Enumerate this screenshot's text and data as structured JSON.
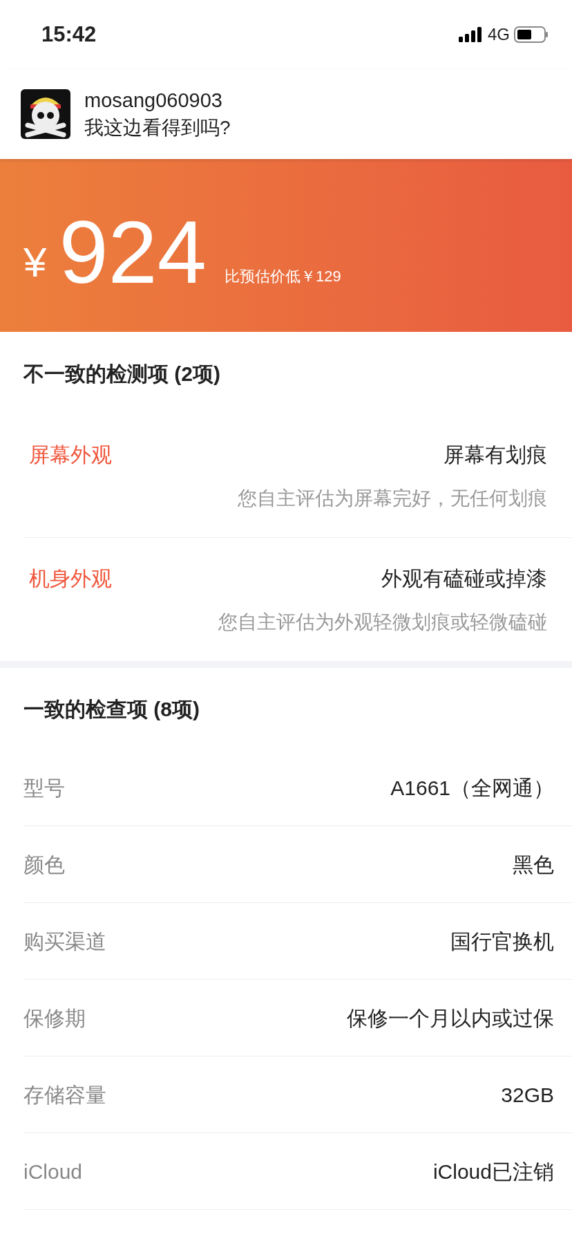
{
  "status_bar": {
    "time": "15:42",
    "network": "4G"
  },
  "notification": {
    "sender": "mosang060903",
    "message": "我这边看得到吗?"
  },
  "price": {
    "currency": "¥",
    "amount": "924",
    "note": "比预估价低￥129"
  },
  "mismatched": {
    "title": "不一致的检测项 (2项)",
    "items": [
      {
        "label": "屏幕外观",
        "value": "屏幕有划痕",
        "self_assessment": "您自主评估为屏幕完好，无任何划痕"
      },
      {
        "label": "机身外观",
        "value": "外观有磕碰或掉漆",
        "self_assessment": "您自主评估为外观轻微划痕或轻微磕碰"
      }
    ]
  },
  "matched": {
    "title": "一致的检查项 (8项)",
    "items": [
      {
        "label": "型号",
        "value": "A1661（全网通）"
      },
      {
        "label": "颜色",
        "value": "黑色"
      },
      {
        "label": "购买渠道",
        "value": "国行官换机"
      },
      {
        "label": "保修期",
        "value": "保修一个月以内或过保"
      },
      {
        "label": "存储容量",
        "value": "32GB"
      },
      {
        "label": "iCloud",
        "value": "iCloud已注销"
      }
    ]
  }
}
